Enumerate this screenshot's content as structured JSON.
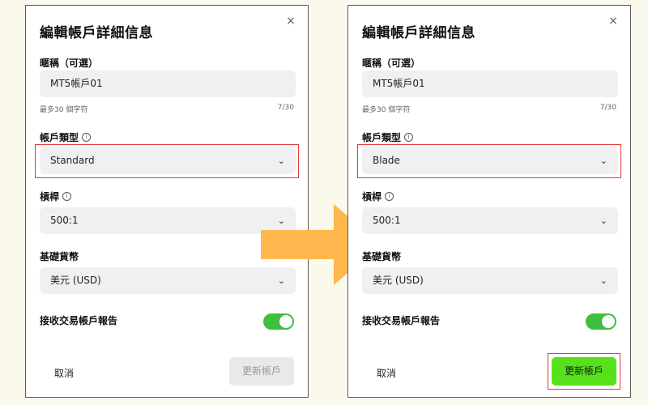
{
  "panels": {
    "left": {
      "title": "編輯帳戶詳細信息",
      "nickname_label": "暱稱（可選）",
      "nickname_value": "MT5帳戶01",
      "nickname_hint": "最多30 個字符",
      "nickname_count": "7/30",
      "account_type_label": "帳戶類型",
      "account_type_value": "Standard",
      "leverage_label": "槓桿",
      "leverage_value": "500:1",
      "currency_label": "基礎貨幣",
      "currency_value": "美元 (USD)",
      "report_label": "接收交易帳戶報告",
      "report_enabled": true,
      "cancel_label": "取消",
      "submit_label": "更新帳戶",
      "submit_enabled": false
    },
    "right": {
      "title": "編輯帳戶詳細信息",
      "nickname_label": "暱稱（可選）",
      "nickname_value": "MT5帳戶01",
      "nickname_hint": "最多30 個字符",
      "nickname_count": "7/30",
      "account_type_label": "帳戶類型",
      "account_type_value": "Blade",
      "leverage_label": "槓桿",
      "leverage_value": "500:1",
      "currency_label": "基礎貨幣",
      "currency_value": "美元 (USD)",
      "report_label": "接收交易帳戶報告",
      "report_enabled": true,
      "cancel_label": "取消",
      "submit_label": "更新帳戶",
      "submit_enabled": true
    }
  },
  "icons": {
    "close": "×",
    "chevron": "⌄",
    "info": "i"
  },
  "colors": {
    "background": "#fbf8ec",
    "highlight": "#e23a3a",
    "toggle_on": "#3fbf3f",
    "submit_active": "#56e11a",
    "arrow": "#ffb84d"
  }
}
